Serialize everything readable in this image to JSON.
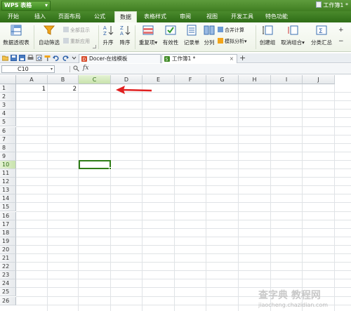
{
  "app": {
    "logo_label": "WPS 表格",
    "logo_dropdown": "▾",
    "workbook_title": "工作簿1 *"
  },
  "menu": {
    "tabs": [
      {
        "label": "开始"
      },
      {
        "label": "插入"
      },
      {
        "label": "页面布局"
      },
      {
        "label": "公式"
      },
      {
        "label": "数据"
      },
      {
        "label": "表格样式"
      },
      {
        "label": "审阅"
      },
      {
        "label": "视图"
      },
      {
        "label": "开发工具"
      },
      {
        "label": "特色功能"
      }
    ],
    "active_tab": "数据"
  },
  "ribbon": {
    "pivot_table": "数据透视表",
    "auto_filter": "自动筛选",
    "show_all": "全部显示",
    "reapply": "重新应用",
    "sort_asc": "升序",
    "sort_desc": "降序",
    "duplicates": "重复项",
    "duplicates_arrow": "▾",
    "validity": "有效性",
    "record_sheet": "记录单",
    "split_column": "分列",
    "consolidate": "合并计算",
    "what_if": "模拟分析",
    "what_if_arrow": "▾",
    "create_group": "创建组",
    "ungroup": "取消组合",
    "ungroup_arrow": "▾",
    "subtotal": "分类汇总",
    "more": "+",
    "more2": "−"
  },
  "doc_tabs": [
    {
      "label": "Docer-在线模板"
    },
    {
      "label": "工作簿1 *"
    }
  ],
  "doc_tab_close": "×",
  "new_tab": "+",
  "formula_bar": {
    "name_box": "C10",
    "name_box_arrow": "▾",
    "fx": "fx",
    "formula_value": ""
  },
  "sheet": {
    "columns": [
      "A",
      "B",
      "C",
      "D",
      "E",
      "F",
      "G",
      "H",
      "I",
      "J"
    ],
    "rows": [
      "1",
      "2",
      "3",
      "4",
      "5",
      "6",
      "7",
      "8",
      "9",
      "10",
      "11",
      "12",
      "13",
      "14",
      "15",
      "16",
      "17",
      "18",
      "19",
      "20",
      "21",
      "22",
      "23",
      "24",
      "25",
      "26"
    ],
    "selected_column": "C",
    "selected_row": "10",
    "cells": [
      {
        "ref": "A1",
        "value": "1"
      },
      {
        "ref": "B1",
        "value": "2"
      }
    ]
  },
  "watermark": {
    "main": "查字典 教程网",
    "sub": "jiaocheng.chazidian.com"
  },
  "colors": {
    "brand_green": "#3f7d22",
    "annotation_red": "#e02020",
    "selection_green": "#2f7d17"
  }
}
